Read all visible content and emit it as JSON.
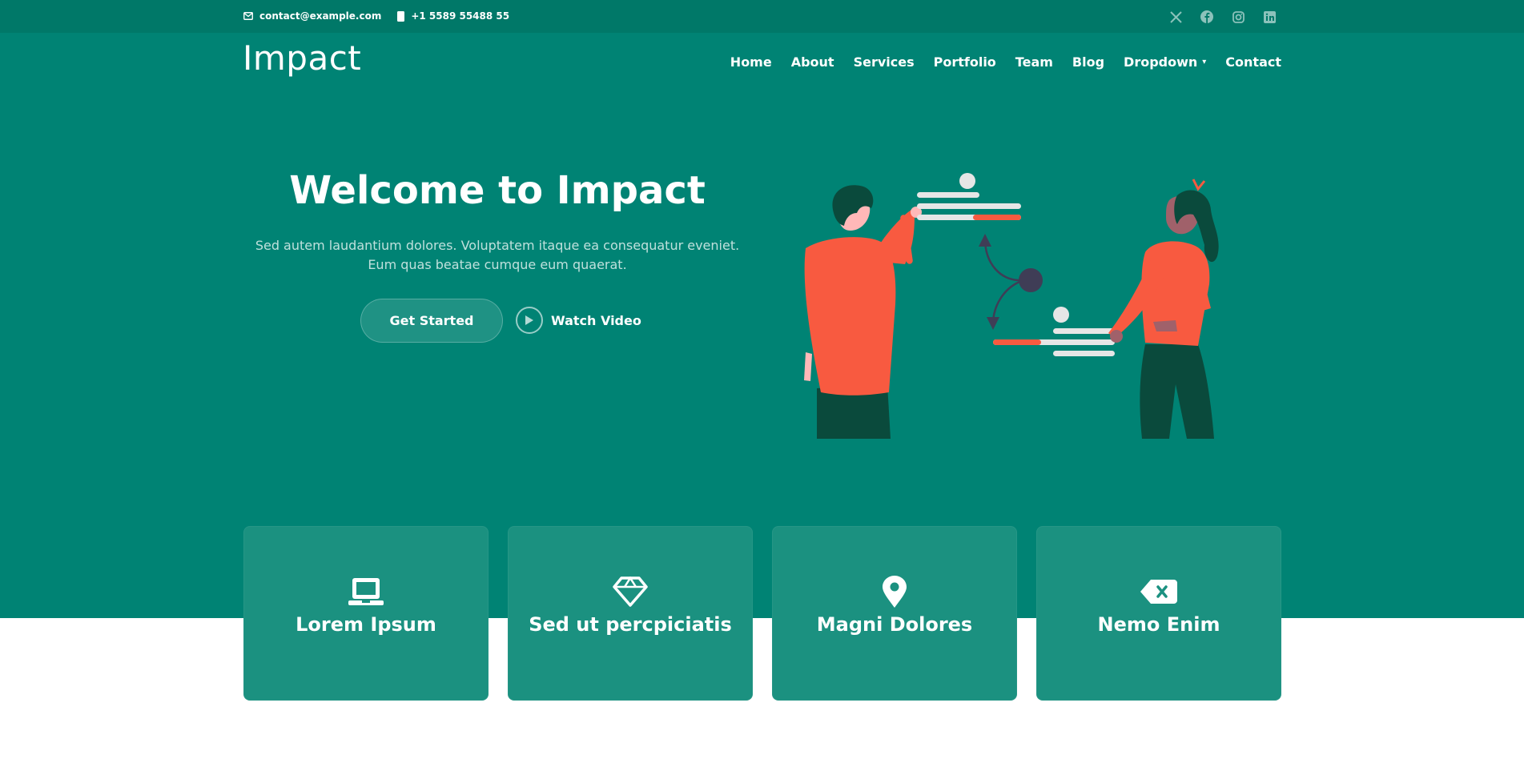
{
  "topbar": {
    "email": "contact@example.com",
    "phone": "+1 5589 55488 55",
    "social": [
      "x-icon",
      "facebook-icon",
      "instagram-icon",
      "linkedin-icon"
    ]
  },
  "header": {
    "logo": "Impact",
    "nav": [
      {
        "label": "Home"
      },
      {
        "label": "About"
      },
      {
        "label": "Services"
      },
      {
        "label": "Portfolio"
      },
      {
        "label": "Team"
      },
      {
        "label": "Blog"
      },
      {
        "label": "Dropdown"
      },
      {
        "label": "Contact"
      }
    ]
  },
  "hero": {
    "title": "Welcome to Impact",
    "subtitle_line1": "Sed autem laudantium dolores. Voluptatem itaque ea consequatur eveniet.",
    "subtitle_line2": "Eum quas beatae cumque eum quaerat.",
    "cta_primary": "Get Started",
    "cta_secondary": "Watch Video"
  },
  "cards": [
    {
      "title": "Lorem Ipsum",
      "icon": "laptop-icon"
    },
    {
      "title": "Sed ut percpiciatis",
      "icon": "gem-icon"
    },
    {
      "title": "Magni Dolores",
      "icon": "map-pin-icon"
    },
    {
      "title": "Nemo Enim",
      "icon": "backspace-icon"
    }
  ],
  "colors": {
    "topbar": "#007868",
    "primary": "#008374",
    "card": "#1b9180",
    "accent": "#f85a40",
    "dark_green": "#0a4a3c"
  }
}
